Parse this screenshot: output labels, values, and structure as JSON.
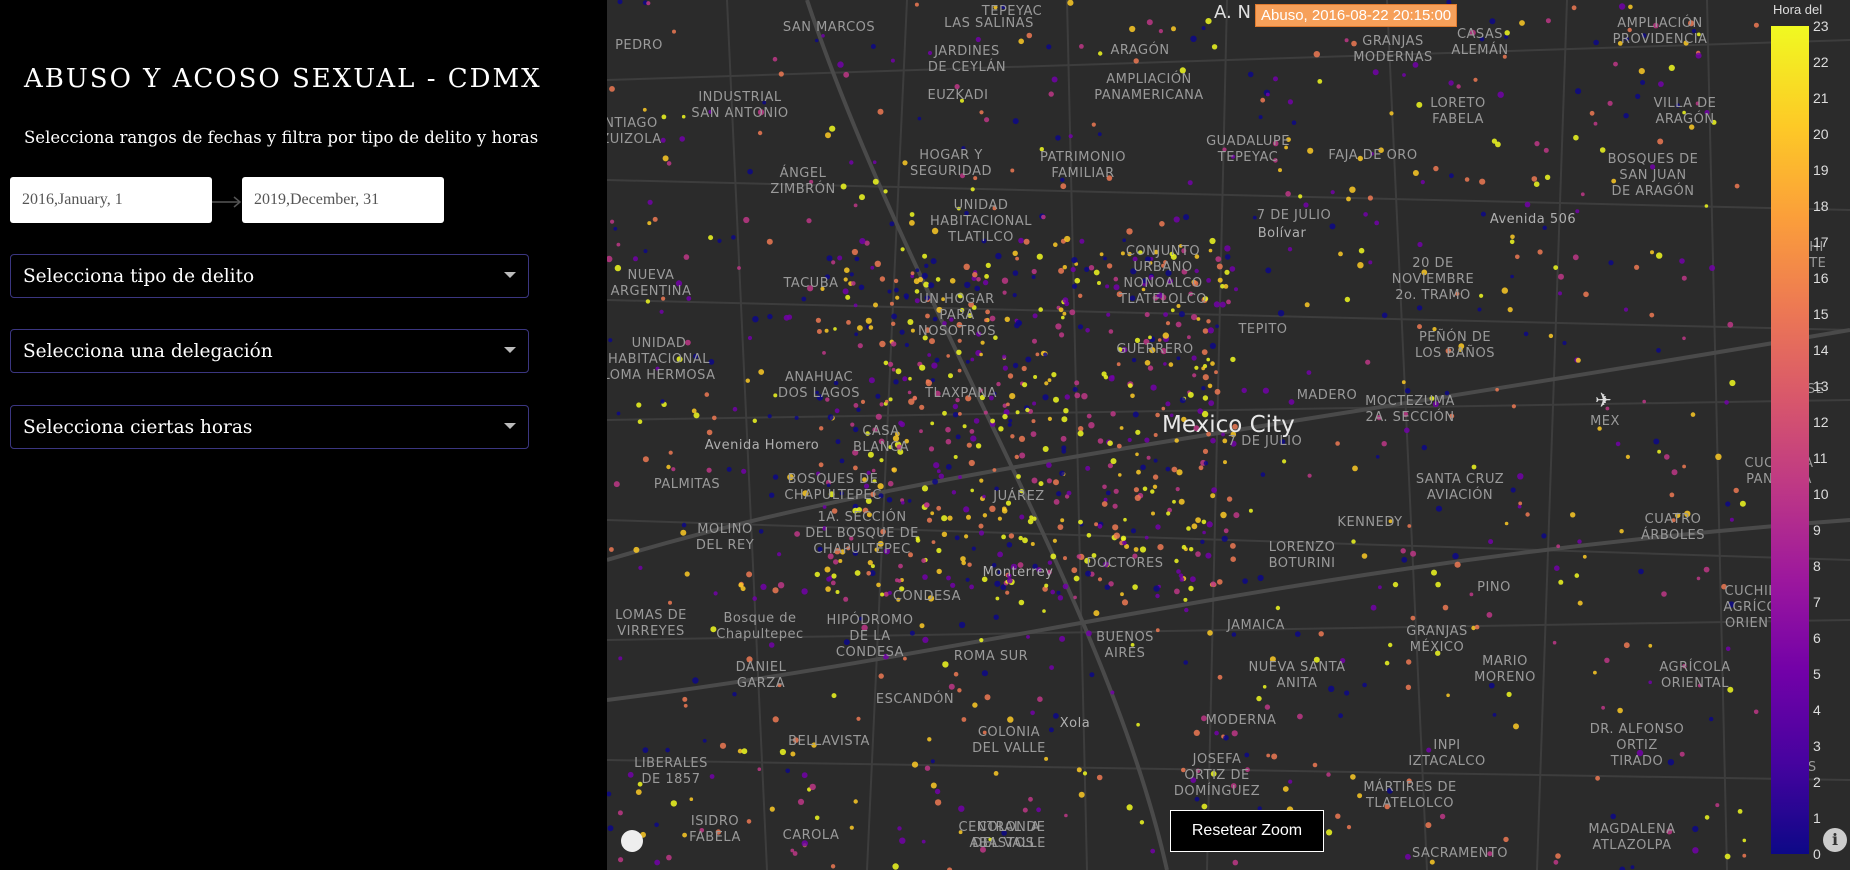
{
  "sidebar": {
    "title": "ABUSO Y ACOSO SEXUAL - CDMX",
    "subtitle": "Selecciona rangos de fechas y filtra por tipo de delito y horas",
    "date_start": "2016,January, 1",
    "date_end": "2019,December, 31",
    "dropdowns": [
      {
        "label": "Selecciona tipo de delito"
      },
      {
        "label": "Selecciona una delegación"
      },
      {
        "label": "Selecciona ciertas horas"
      }
    ]
  },
  "map": {
    "city_label": "Mexico City",
    "tooltip_prefix": "A. N",
    "tooltip": "Abuso, 2016-08-22 20:15:00",
    "reset_button": "Resetear Zoom",
    "airport_code": "MEX",
    "info_glyph": "i",
    "colorbar": {
      "title": "Hora del",
      "ticks": [
        "0",
        "1",
        "2",
        "3",
        "4",
        "5",
        "6",
        "7",
        "8",
        "9",
        "10",
        "11",
        "12",
        "13",
        "14",
        "15",
        "16",
        "17",
        "18",
        "19",
        "20",
        "21",
        "22",
        "23"
      ],
      "colorscale": [
        "#0d0887",
        "#7201a8",
        "#bd3786",
        "#ed7953",
        "#fdca26",
        "#f0f921"
      ]
    },
    "neighborhoods": [
      {
        "text": "TEPEYAC"
      },
      {
        "text": "SAN MARCOS"
      },
      {
        "text": "LAS SALINAS"
      },
      {
        "text": "PEDRO"
      },
      {
        "text": "JARDINES\nDE CEYLÁN"
      },
      {
        "text": "ARAGÓN"
      },
      {
        "text": "GRANJAS\nMODERNAS"
      },
      {
        "text": "CASAS\nALEMÁN"
      },
      {
        "text": "AMPLIACIÓN\nPROVIDENCIA"
      },
      {
        "text": "INDUSTRIAL\nSAN ANTONIO"
      },
      {
        "text": "EUZKADI"
      },
      {
        "text": "AMPLIACIÓN\nPANAMERICANA"
      },
      {
        "text": "LORETO\nFABELA"
      },
      {
        "text": "VILLA DE\nARAGÓN"
      },
      {
        "text": "NTIAGO\nZUIZOLA"
      },
      {
        "text": "HOGAR Y\nSEGURIDAD"
      },
      {
        "text": "PATRIMONIO\nFAMILIAR"
      },
      {
        "text": "GUADALUPE\nTEPEYAC"
      },
      {
        "text": "FAJA DE ORO"
      },
      {
        "text": "BOSQUES DE\nSAN JUAN\nDE ARAGÓN"
      },
      {
        "text": "ÁNGEL\nZIMBRÓN"
      },
      {
        "text": "UNIDAD\nHABITACIONAL\nTLATILCO"
      },
      {
        "text": "7 DE JULIO"
      },
      {
        "text": "CONJUNTO\nURBANO\nNONOALCO\nTLATELOLCO"
      },
      {
        "text": "20 DE\nNOVIEMBRE\n2o. TRAMO"
      },
      {
        "text": "CUCHI\nDEL TE"
      },
      {
        "text": "NUEVA\nARGENTINA"
      },
      {
        "text": "TACUBA"
      },
      {
        "text": "UN HOGAR\nPARA\nNOSOTROS"
      },
      {
        "text": "TEPITO"
      },
      {
        "text": "PEÑÓN DE\nLOS BAÑOS"
      },
      {
        "text": "UNIDAD\nHABITACIONAL\nLOMA HERMOSA"
      },
      {
        "text": "ANAHUAC\nDOS LAGOS"
      },
      {
        "text": "TLAXPANA"
      },
      {
        "text": "GUERRERO"
      },
      {
        "text": "MADERO"
      },
      {
        "text": "MOCTEZUMA\n2A. SECCIÓN"
      },
      {
        "text": "4A. SE"
      },
      {
        "text": "CASA\nBLANCA"
      },
      {
        "text": "7 DE JULIO"
      },
      {
        "text": "PALMITAS"
      },
      {
        "text": "BOSQUES DE\nCHAPULTEPEC"
      },
      {
        "text": "JUÁREZ"
      },
      {
        "text": "SANTA CRUZ\nAVIACIÓN"
      },
      {
        "text": "CUCHILLA\nPANTITLÁ"
      },
      {
        "text": "MOLINO\nDEL REY"
      },
      {
        "text": "1A. SECCIÓN\nDEL BOSQUE DE\nCHAPULTEPEC"
      },
      {
        "text": "DOCTORES"
      },
      {
        "text": "LORENZO\nBOTURINI"
      },
      {
        "text": "KENNEDY"
      },
      {
        "text": "CUATRO\nÁRBOLES"
      },
      {
        "text": "LOMAS DE\nVIRREYES"
      },
      {
        "text": "CONDESA"
      },
      {
        "text": "PINO"
      },
      {
        "text": "CUCHILLA\nAGRÍCOLA\nORIENTAL"
      },
      {
        "text": "Bosque de\nChapultepec"
      },
      {
        "text": "HIPÓDROMO\nDE LA\nCONDESA"
      },
      {
        "text": "BUENOS\nAIRES"
      },
      {
        "text": "JAMAICA"
      },
      {
        "text": "GRANJAS\nMÉXICO"
      },
      {
        "text": "DANIEL\nGARZA"
      },
      {
        "text": "ROMA SUR"
      },
      {
        "text": "NUEVA SANTA\nANITA"
      },
      {
        "text": "MARIO\nMORENO"
      },
      {
        "text": "AGRÍCOLA\nORIENTAL"
      },
      {
        "text": "ESCANDÓN"
      },
      {
        "text": "MODERNA"
      },
      {
        "text": "BELLAVISTA"
      },
      {
        "text": "COLONIA\nDEL VALLE"
      },
      {
        "text": "DR. ALFONSO\nORTIZ\nTIRADO"
      },
      {
        "text": "INPI\nIZTACALCO"
      },
      {
        "text": "LIBERALES\nDE 1857"
      },
      {
        "text": "JOSEFA\nORTIZ DE\nDOMÍNGUEZ"
      },
      {
        "text": "MÁRTIRES DE\nTLATELOLCO"
      },
      {
        "text": "CONS"
      },
      {
        "text": "ISIDRO\nFABELA"
      },
      {
        "text": "CAROLA"
      },
      {
        "text": "COLONIA\nDEL VALLE"
      },
      {
        "text": "CENTRAL DE\nABASTOS"
      },
      {
        "text": "MAGDALENA\nATLAZOLPA"
      },
      {
        "text": "SACRAMENTO"
      }
    ],
    "street_labels": [
      {
        "text": "Avenida Homero"
      },
      {
        "text": "Avenida 506"
      },
      {
        "text": "Bolívar"
      },
      {
        "text": "Monterrey"
      },
      {
        "text": "Xola"
      }
    ]
  }
}
